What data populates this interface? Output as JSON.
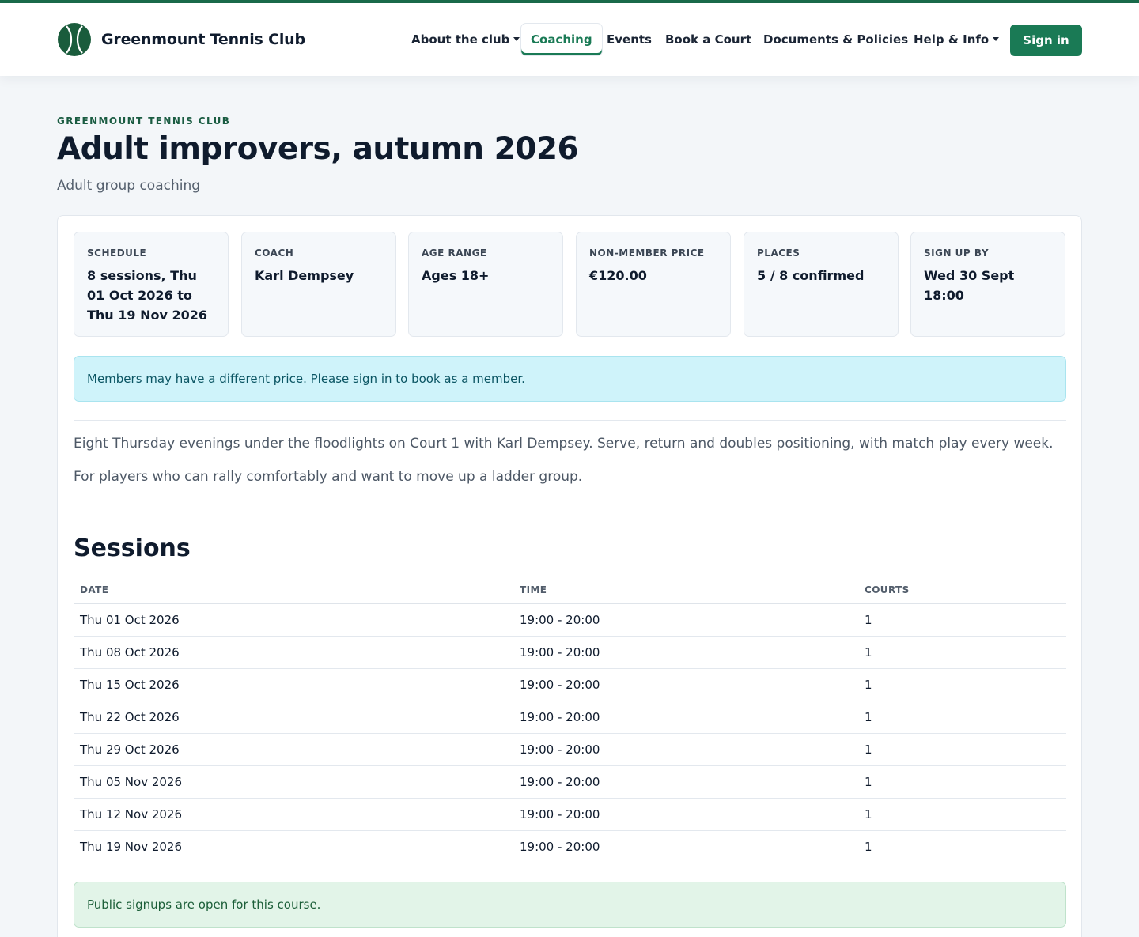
{
  "header": {
    "brand_name": "Greenmount Tennis Club",
    "nav": [
      {
        "label": "About the club",
        "dropdown": true,
        "active": false
      },
      {
        "label": "Coaching",
        "dropdown": false,
        "active": true
      },
      {
        "label": "Events",
        "dropdown": false,
        "active": false
      },
      {
        "label": "Book a Court",
        "dropdown": false,
        "active": false
      },
      {
        "label": "Documents & Policies",
        "dropdown": false,
        "active": false
      },
      {
        "label": "Help & Info",
        "dropdown": true,
        "active": false
      }
    ],
    "signin_label": "Sign in"
  },
  "page": {
    "eyebrow": "GREENMOUNT TENNIS CLUB",
    "title": "Adult improvers, autumn 2026",
    "subtitle": "Adult group coaching"
  },
  "stats": [
    {
      "label": "SCHEDULE",
      "value": "8 sessions, Thu 01 Oct 2026 to Thu 19 Nov 2026"
    },
    {
      "label": "COACH",
      "value": "Karl Dempsey"
    },
    {
      "label": "AGE RANGE",
      "value": "Ages 18+"
    },
    {
      "label": "NON-MEMBER PRICE",
      "value": "€120.00"
    },
    {
      "label": "PLACES",
      "value": "5 / 8 confirmed"
    },
    {
      "label": "SIGN UP BY",
      "value": "Wed 30 Sept 18:00"
    }
  ],
  "member_notice": "Members may have a different price. Please sign in to book as a member.",
  "description": [
    "Eight Thursday evenings under the floodlights on Court 1 with Karl Dempsey. Serve, return and doubles positioning, with match play every week.",
    "For players who can rally comfortably and want to move up a ladder group."
  ],
  "sessions": {
    "heading": "Sessions",
    "columns": [
      "DATE",
      "TIME",
      "COURTS"
    ],
    "rows": [
      [
        "Thu 01 Oct 2026",
        "19:00 - 20:00",
        "1"
      ],
      [
        "Thu 08 Oct 2026",
        "19:00 - 20:00",
        "1"
      ],
      [
        "Thu 15 Oct 2026",
        "19:00 - 20:00",
        "1"
      ],
      [
        "Thu 22 Oct 2026",
        "19:00 - 20:00",
        "1"
      ],
      [
        "Thu 29 Oct 2026",
        "19:00 - 20:00",
        "1"
      ],
      [
        "Thu 05 Nov 2026",
        "19:00 - 20:00",
        "1"
      ],
      [
        "Thu 12 Nov 2026",
        "19:00 - 20:00",
        "1"
      ],
      [
        "Thu 19 Nov 2026",
        "19:00 - 20:00",
        "1"
      ]
    ]
  },
  "signup_status": "Public signups are open for this course.",
  "colors": {
    "brand_green": "#1a7a55",
    "info_bg": "#cff3fa",
    "success_bg": "#e2f4e8"
  },
  "icons": {
    "brand_logo": "tennis-ball-icon"
  }
}
